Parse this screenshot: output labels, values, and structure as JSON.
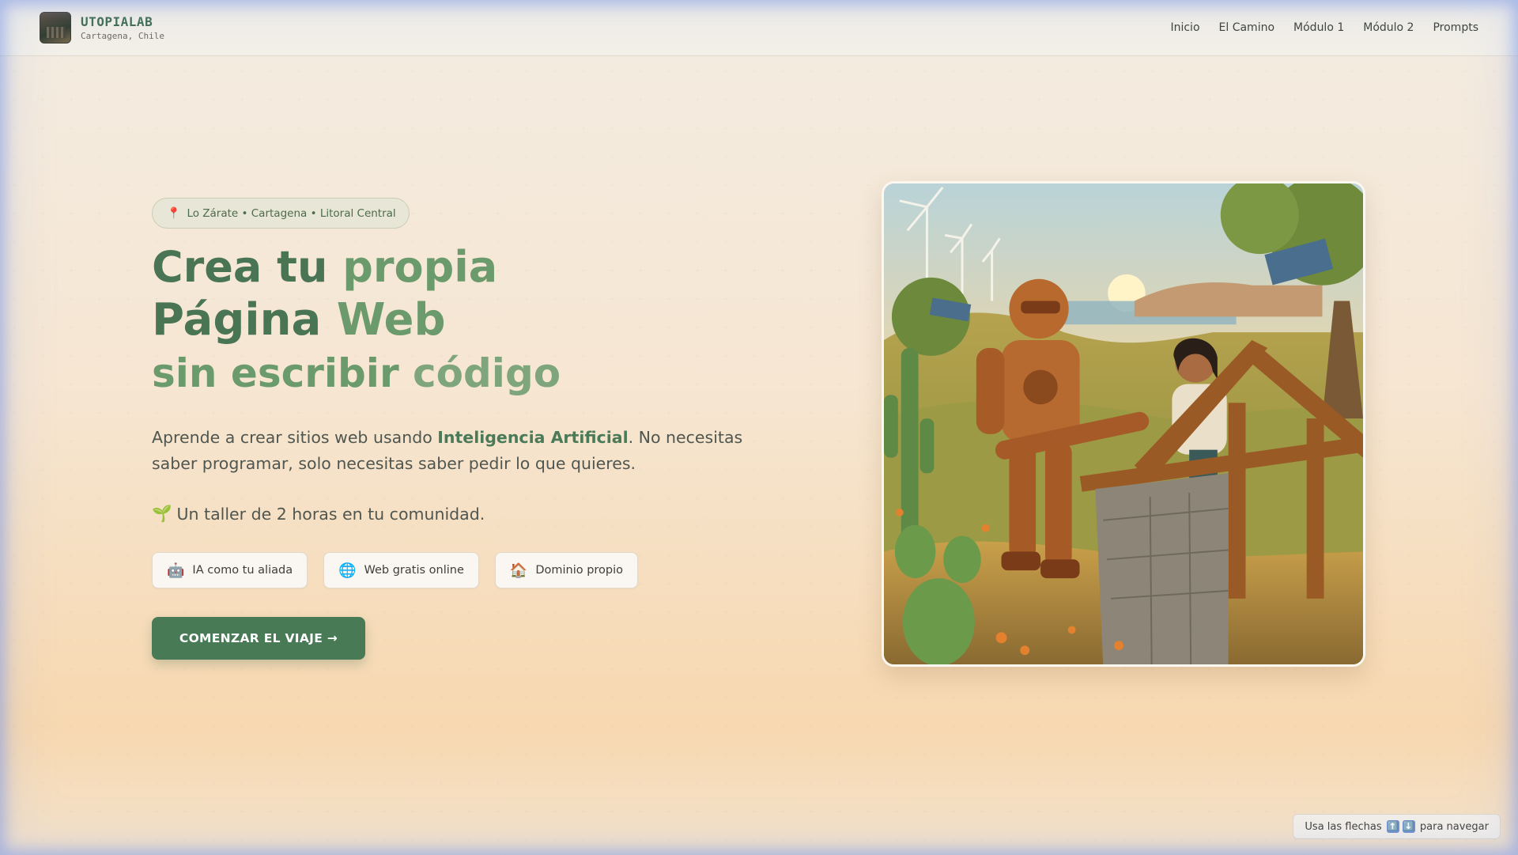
{
  "nav": {
    "brand_name": "UTOPIALAB",
    "brand_location": "Cartagena, Chile",
    "links": [
      "Inicio",
      "El Camino",
      "Módulo 1",
      "Módulo 2",
      "Prompts"
    ]
  },
  "hero": {
    "location_pill": "Lo Zárate • Cartagena • Litoral Central",
    "headline": {
      "line1_a": "Crea tu",
      "line1_b": "propia",
      "line2_a": "Página",
      "line2_b": "Web",
      "line3_a": "sin escribir",
      "line3_b": "código"
    },
    "description_pre": "Aprende a crear sitios web usando ",
    "description_highlight": "Inteligencia Artificial",
    "description_post": ". No necesitas saber programar, solo necesitas saber pedir lo que quieres.",
    "workshop_icon": "🌱",
    "workshop_text": "Un taller de 2 horas en tu comunidad.",
    "chips": [
      {
        "icon": "🤖",
        "label": "IA como tu aliada"
      },
      {
        "icon": "🌐",
        "label": "Web gratis online"
      },
      {
        "icon": "🏠",
        "label": "Dominio propio"
      }
    ],
    "cta_label": "COMENZAR EL VIAJE →"
  },
  "hint": {
    "pre": "Usa las flechas",
    "key_up": "⬆️",
    "key_down": "⬇️",
    "post": "para navegar"
  },
  "colors": {
    "accent": "#477a55",
    "headline_dark": "#4a7555",
    "headline_light": "#7ea57b"
  }
}
